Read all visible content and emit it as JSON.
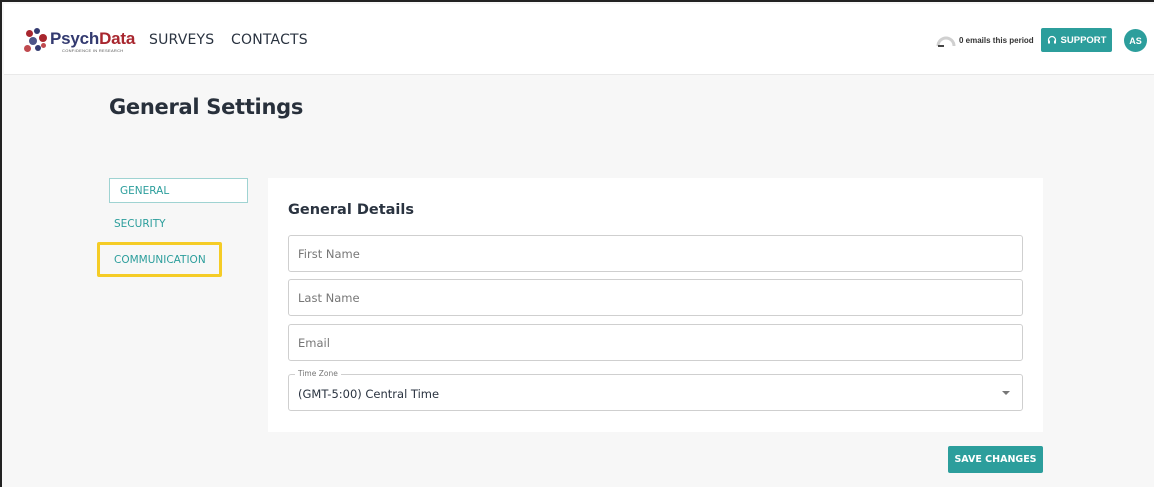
{
  "brand": {
    "name_part1": "Psych",
    "name_part2": "Data",
    "tagline": "CONFIDENCE IN RESEARCH"
  },
  "nav": {
    "surveys": "SURVEYS",
    "contacts": "CONTACTS"
  },
  "header": {
    "email_usage": "0 emails this period",
    "support_label": "SUPPORT",
    "avatar_initials": "AS"
  },
  "page": {
    "title": "General Settings"
  },
  "sidebar": {
    "items": [
      {
        "label": "GENERAL",
        "active": true
      },
      {
        "label": "SECURITY",
        "active": false
      },
      {
        "label": "COMMUNICATION",
        "active": false,
        "highlighted": true
      }
    ]
  },
  "form": {
    "title": "General Details",
    "first_name": {
      "value": "",
      "placeholder": "First Name"
    },
    "last_name": {
      "value": "",
      "placeholder": "Last Name"
    },
    "email": {
      "value": "",
      "placeholder": "Email"
    },
    "time_zone": {
      "label": "Time Zone",
      "value": "(GMT-5:00) Central Time"
    },
    "save_label": "SAVE CHANGES"
  },
  "colors": {
    "accent": "#2c9e9c",
    "highlight": "#f5cc26",
    "brand_blue": "#333a70",
    "brand_red": "#a8262e"
  },
  "icons": {
    "support": "headset-icon",
    "select_caret": "caret-down-icon",
    "email_meter": "gauge-icon"
  }
}
